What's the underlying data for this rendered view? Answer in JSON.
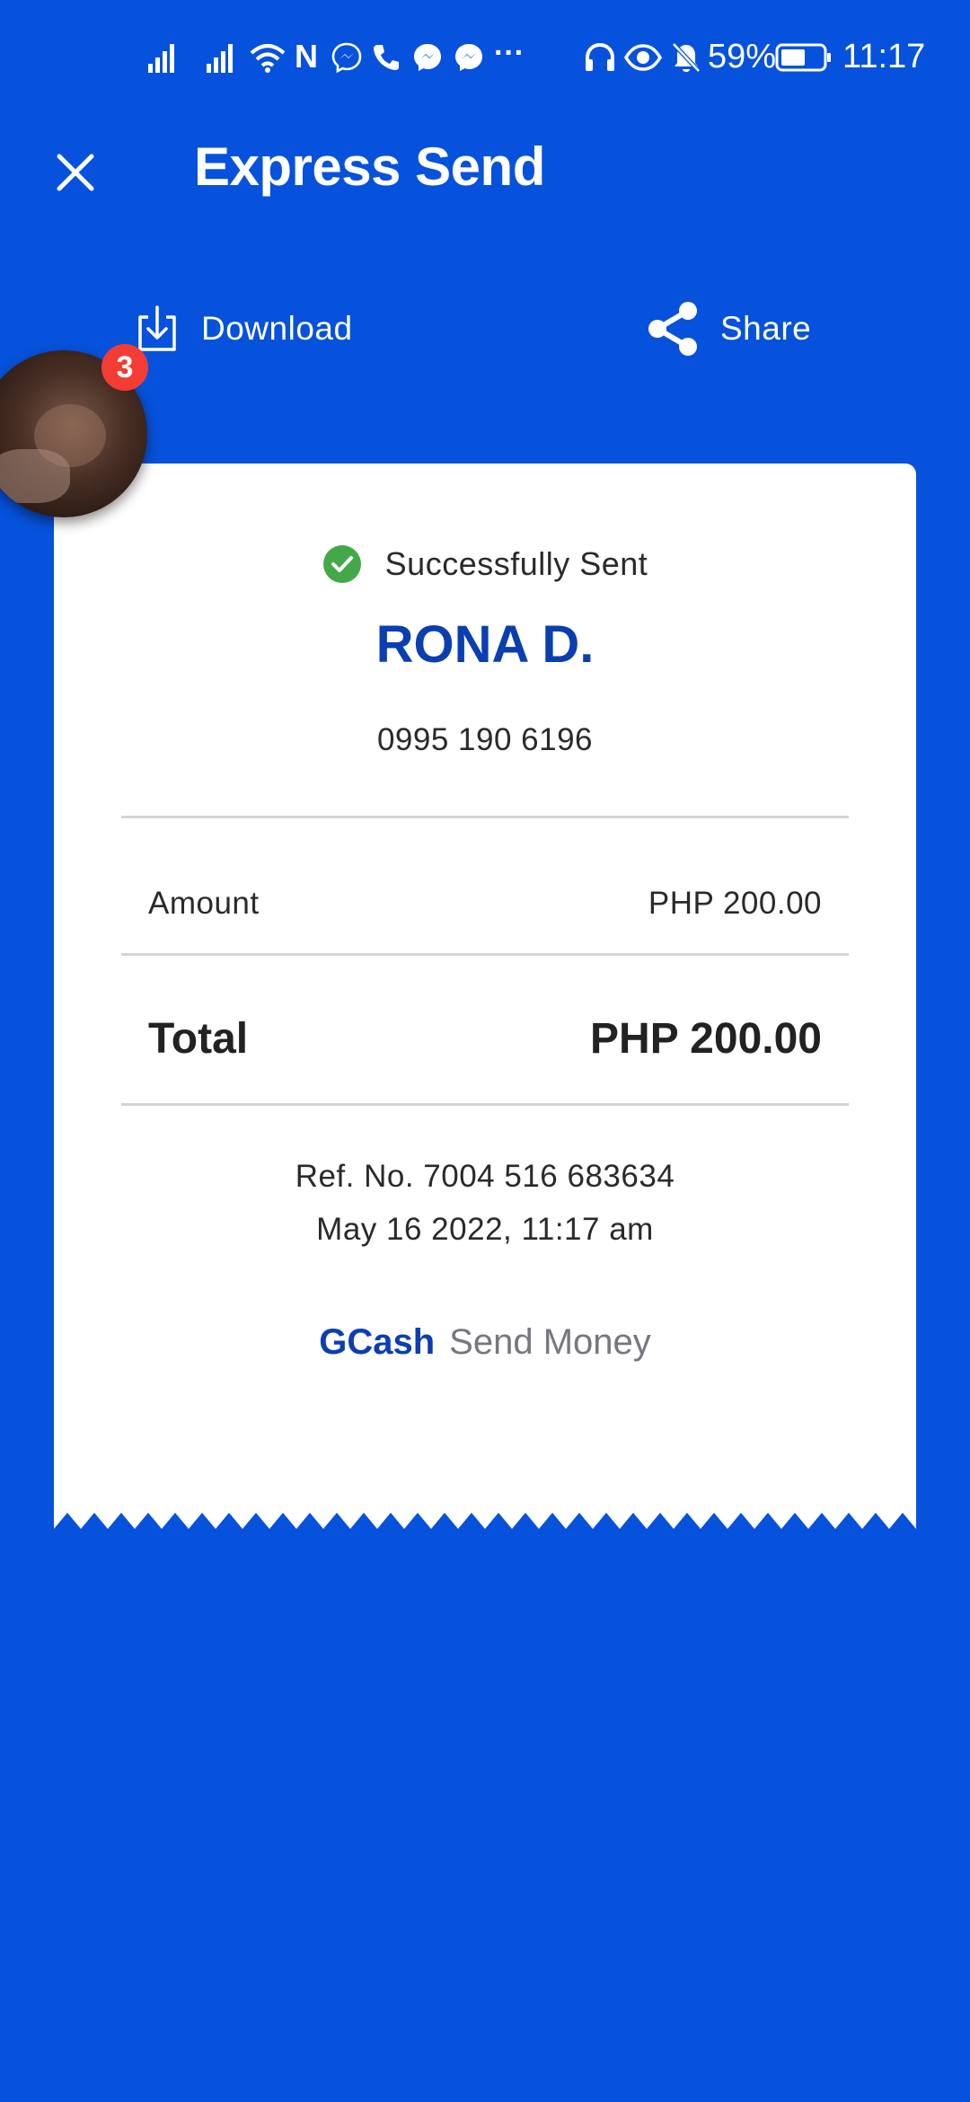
{
  "status_bar": {
    "signal_1_icon": "signal-bars-icon",
    "signal_2_icon": "signal-bars-icon",
    "wifi_icon": "wifi-icon",
    "nfc_label": "N",
    "more_label": "···",
    "battery_percent": "59%",
    "battery_level": 0.59,
    "time": "11:17"
  },
  "header": {
    "title": "Express Send"
  },
  "actions": {
    "download_label": "Download",
    "share_label": "Share"
  },
  "chat_head": {
    "badge_count": "3"
  },
  "receipt": {
    "status": "Successfully Sent",
    "recipient_name": "RONA D.",
    "recipient_phone": "0995 190 6196",
    "amount_label": "Amount",
    "amount_value": "PHP 200.00",
    "total_label": "Total",
    "total_value": "PHP 200.00",
    "ref_number": "Ref. No. 7004 516 683634",
    "datetime": "May 16 2022, 11:17 am",
    "brand_name": "GCash",
    "brand_service": "Send Money"
  },
  "colors": {
    "background": "#0752dc",
    "accent_text": "#0b3fb1",
    "success": "#43a948",
    "badge": "#f23c34"
  }
}
